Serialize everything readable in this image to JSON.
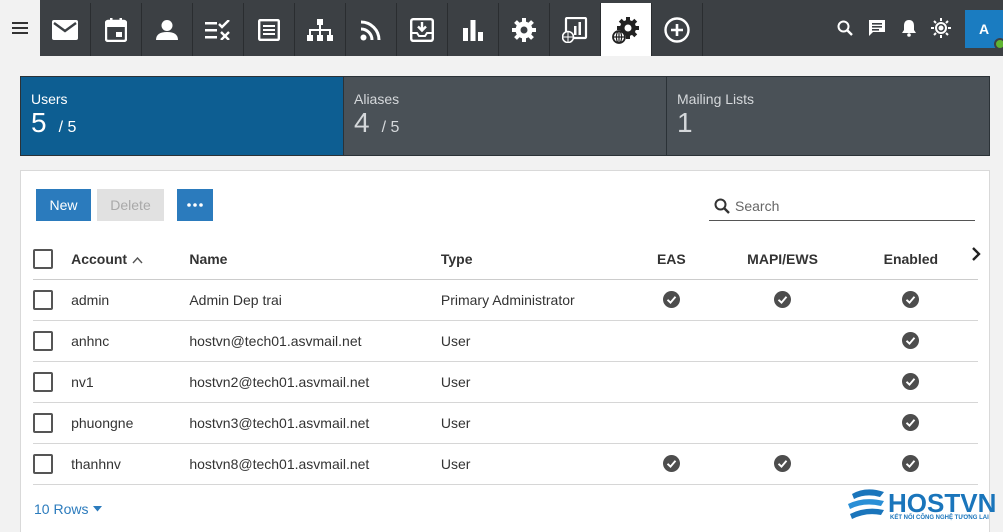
{
  "toolbar": {
    "tabs": [
      {
        "icon": "mail-icon"
      },
      {
        "icon": "calendar-icon"
      },
      {
        "icon": "contacts-icon"
      },
      {
        "icon": "tasks-icon"
      },
      {
        "icon": "notes-icon"
      },
      {
        "icon": "sitemap-icon"
      },
      {
        "icon": "rss-icon"
      },
      {
        "icon": "inbox-download-icon"
      },
      {
        "icon": "bar-chart-icon"
      },
      {
        "icon": "gear-icon"
      },
      {
        "icon": "domain-reports-icon"
      },
      {
        "icon": "domain-settings-icon",
        "active": true
      },
      {
        "icon": "add-circle-icon"
      }
    ],
    "right_icons": [
      "search-icon",
      "chat-icon",
      "bell-icon",
      "brightness-icon"
    ],
    "avatar_initial": "A",
    "colors": {
      "bar": "#3c4044",
      "accent": "#1a7cc1",
      "presence": "#5fb432"
    }
  },
  "summary": {
    "users": {
      "label": "Users",
      "value": "5",
      "max": "/ 5"
    },
    "aliases": {
      "label": "Aliases",
      "value": "4",
      "max": "/ 5"
    },
    "mailing_lists": {
      "label": "Mailing Lists",
      "value": "1"
    }
  },
  "actions": {
    "new_label": "New",
    "delete_label": "Delete",
    "more_label": "•••"
  },
  "search": {
    "placeholder": "Search"
  },
  "table": {
    "columns": {
      "account": "Account",
      "name": "Name",
      "type": "Type",
      "eas": "EAS",
      "mapi": "MAPI/EWS",
      "enabled": "Enabled"
    },
    "rows": [
      {
        "account": "admin",
        "name": "Admin Dep trai",
        "type": "Primary Administrator",
        "eas": true,
        "mapi": true,
        "enabled": true
      },
      {
        "account": "anhnc",
        "name": "hostvn@tech01.asvmail.net",
        "type": "User",
        "eas": false,
        "mapi": false,
        "enabled": true
      },
      {
        "account": "nv1",
        "name": "hostvn2@tech01.asvmail.net",
        "type": "User",
        "eas": false,
        "mapi": false,
        "enabled": true
      },
      {
        "account": "phuongne",
        "name": "hostvn3@tech01.asvmail.net",
        "type": "User",
        "eas": false,
        "mapi": false,
        "enabled": true
      },
      {
        "account": "thanhnv",
        "name": "hostvn8@tech01.asvmail.net",
        "type": "User",
        "eas": true,
        "mapi": true,
        "enabled": true
      }
    ]
  },
  "pagination": {
    "rows_label": "10 Rows"
  },
  "watermark": {
    "brand": "HOSTVN",
    "tagline": "KẾT NỐI CÔNG NGHỆ TƯƠNG LAI"
  }
}
